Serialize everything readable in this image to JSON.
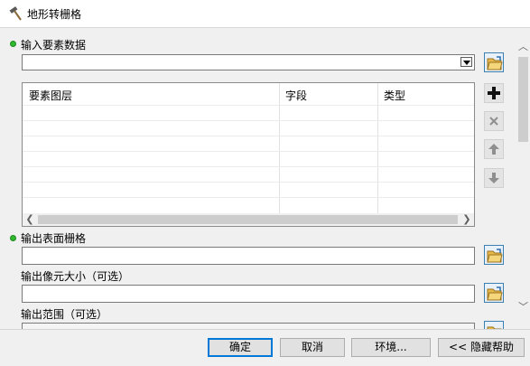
{
  "window": {
    "title": "地形转栅格",
    "icon": "hammer-icon"
  },
  "params": {
    "input_features": {
      "label": "输入要素数据",
      "value": "",
      "table": {
        "columns": [
          "要素图层",
          "字段",
          "类型"
        ],
        "rows": []
      }
    },
    "output_surface": {
      "label": "输出表面栅格",
      "value": ""
    },
    "cell_size": {
      "label": "输出像元大小（可选）",
      "value": ""
    },
    "extent": {
      "label": "输出范围（可选）"
    }
  },
  "side_buttons": [
    "add-icon",
    "remove-icon",
    "up-arrow-icon",
    "down-arrow-icon"
  ],
  "colors": {
    "required_dot": "#2fb82f",
    "accent": "#0078d7"
  },
  "buttons": {
    "ok": "确定",
    "cancel": "取消",
    "environments": "环境...",
    "hide_help": "<< 隐藏帮助"
  }
}
